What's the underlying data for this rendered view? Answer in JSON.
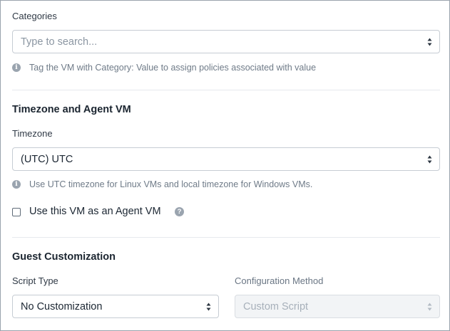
{
  "categories": {
    "label": "Categories",
    "placeholder": "Type to search...",
    "help_text": "Tag the VM with Category: Value to assign policies associated with value"
  },
  "timezone_section": {
    "heading": "Timezone and Agent VM",
    "timezone_label": "Timezone",
    "timezone_value": "(UTC) UTC",
    "help_text": "Use UTC timezone for Linux VMs and local timezone for Windows VMs.",
    "agent_vm_label": "Use this VM as an Agent VM",
    "agent_vm_checked": false
  },
  "guest_customization": {
    "heading": "Guest Customization",
    "script_type_label": "Script Type",
    "script_type_value": "No Customization",
    "config_method_label": "Configuration Method",
    "config_method_value": "Custom Script"
  },
  "icons": {
    "info": "info-icon",
    "help": "question-icon",
    "select_arrows": "chevron-up-down-icon"
  }
}
